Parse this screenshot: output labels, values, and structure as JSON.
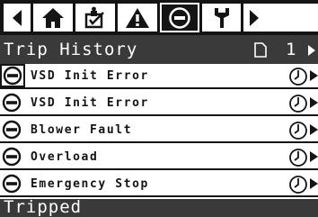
{
  "tabs": [
    {
      "name": "scroll-left",
      "icon": "left-arrow-icon"
    },
    {
      "name": "home",
      "icon": "home-icon"
    },
    {
      "name": "event-log",
      "icon": "checklist-icon"
    },
    {
      "name": "alarms",
      "icon": "warning-icon"
    },
    {
      "name": "trips",
      "icon": "stop-icon",
      "active": true
    },
    {
      "name": "service",
      "icon": "wrench-icon"
    },
    {
      "name": "scroll-right",
      "icon": "right-arrow-icon"
    }
  ],
  "header": {
    "title": "Trip History",
    "page_icon": "page-icon",
    "page_number": "1"
  },
  "trips": [
    {
      "label": "VSD Init Error",
      "icon": "stop-icon",
      "detail_icon": "clock-icon",
      "selected": true
    },
    {
      "label": "VSD Init Error",
      "icon": "stop-icon",
      "detail_icon": "clock-icon"
    },
    {
      "label": "Blower Fault",
      "icon": "stop-icon",
      "detail_icon": "clock-icon"
    },
    {
      "label": "Overload",
      "icon": "stop-icon",
      "detail_icon": "clock-icon"
    },
    {
      "label": "Emergency Stop",
      "icon": "stop-icon",
      "detail_icon": "clock-icon"
    }
  ],
  "status": {
    "text": "Tripped"
  },
  "colors": {
    "background": "#141414",
    "bar": "#3a3a3a",
    "foreground": "#ffffff"
  }
}
